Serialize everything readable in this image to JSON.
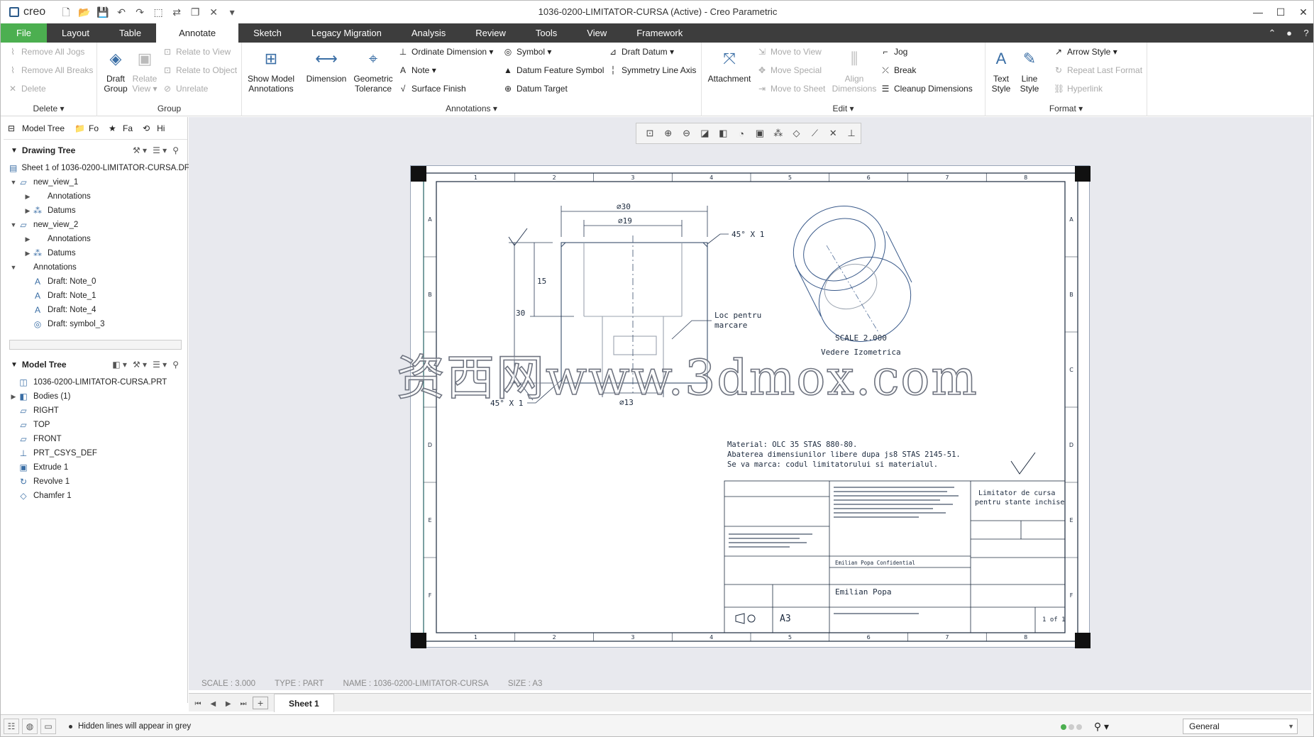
{
  "window": {
    "app_name": "creo",
    "title": "1036-0200-LIMITATOR-CURSA (Active) - Creo Parametric"
  },
  "tabs": [
    "File",
    "Layout",
    "Table",
    "Annotate",
    "Sketch",
    "Legacy Migration",
    "Analysis",
    "Review",
    "Tools",
    "View",
    "Framework"
  ],
  "ribbon": {
    "delete_group": {
      "label": "Delete",
      "remove_all_jogs": "Remove All Jogs",
      "remove_all_breaks": "Remove All Breaks",
      "delete": "Delete"
    },
    "group_group": {
      "label": "Group",
      "draft_group": "Draft Group",
      "relate_view": "Relate View",
      "relate_to_view": "Relate to View",
      "relate_to_object": "Relate to Object",
      "unrelate": "Unrelate"
    },
    "annotations_group": {
      "label": "Annotations",
      "show_model_annotations": "Show Model Annotations",
      "dimension": "Dimension",
      "geometric_tolerance": "Geometric Tolerance",
      "ordinate_dimension": "Ordinate Dimension",
      "note": "Note",
      "surface_finish": "Surface Finish",
      "symbol": "Symbol",
      "datum_feature_symbol": "Datum Feature Symbol",
      "datum_target": "Datum Target",
      "draft_datum": "Draft Datum",
      "symmetry_line_axis": "Symmetry Line Axis"
    },
    "edit_group": {
      "label": "Edit",
      "attachment": "Attachment",
      "move_to_view": "Move to View",
      "move_special": "Move Special",
      "move_to_sheet": "Move to Sheet",
      "align_dimensions": "Align Dimensions",
      "jog": "Jog",
      "break": "Break",
      "cleanup_dimensions": "Cleanup Dimensions"
    },
    "format_group": {
      "label": "Format",
      "text_style": "Text Style",
      "line_style": "Line Style",
      "arrow_style": "Arrow Style",
      "repeat_last_format": "Repeat Last Format",
      "hyperlink": "Hyperlink"
    }
  },
  "left_panel": {
    "tabs": [
      "Model Tree",
      "Fo",
      "Fa",
      "Hi"
    ],
    "drawing_tree": {
      "title": "Drawing Tree",
      "items": [
        {
          "label": "Sheet 1 of 1036-0200-LIMITATOR-CURSA.DF",
          "level": 0,
          "tw": "",
          "icon": "sheet-icon"
        },
        {
          "label": "new_view_1",
          "level": 0,
          "tw": "▼",
          "icon": "view-icon"
        },
        {
          "label": "Annotations",
          "level": 1,
          "tw": "▶",
          "icon": ""
        },
        {
          "label": "Datums",
          "level": 1,
          "tw": "▶",
          "icon": "datum-icon"
        },
        {
          "label": "new_view_2",
          "level": 0,
          "tw": "▼",
          "icon": "view-icon"
        },
        {
          "label": "Annotations",
          "level": 1,
          "tw": "▶",
          "icon": ""
        },
        {
          "label": "Datums",
          "level": 1,
          "tw": "▶",
          "icon": "datum-icon"
        },
        {
          "label": "Annotations",
          "level": 0,
          "tw": "▼",
          "icon": ""
        },
        {
          "label": "Draft: Note_0",
          "level": 1,
          "tw": "",
          "icon": "note-icon"
        },
        {
          "label": "Draft: Note_1",
          "level": 1,
          "tw": "",
          "icon": "note-icon"
        },
        {
          "label": "Draft: Note_4",
          "level": 1,
          "tw": "",
          "icon": "note-icon"
        },
        {
          "label": "Draft: symbol_3",
          "level": 1,
          "tw": "",
          "icon": "symbol-icon"
        }
      ]
    },
    "model_tree": {
      "title": "Model Tree",
      "items": [
        {
          "label": "1036-0200-LIMITATOR-CURSA.PRT",
          "level": 0,
          "tw": "",
          "icon": "part-icon"
        },
        {
          "label": "Bodies (1)",
          "level": 0,
          "tw": "▶",
          "icon": "bodies-icon"
        },
        {
          "label": "RIGHT",
          "level": 0,
          "tw": "",
          "icon": "plane-icon"
        },
        {
          "label": "TOP",
          "level": 0,
          "tw": "",
          "icon": "plane-icon"
        },
        {
          "label": "FRONT",
          "level": 0,
          "tw": "",
          "icon": "plane-icon"
        },
        {
          "label": "PRT_CSYS_DEF",
          "level": 0,
          "tw": "",
          "icon": "csys-icon"
        },
        {
          "label": "Extrude 1",
          "level": 0,
          "tw": "",
          "icon": "extrude-icon"
        },
        {
          "label": "Revolve 1",
          "level": 0,
          "tw": "",
          "icon": "revolve-icon"
        },
        {
          "label": "Chamfer 1",
          "level": 0,
          "tw": "",
          "icon": "chamfer-icon"
        }
      ]
    }
  },
  "drawing": {
    "cols": [
      "1",
      "2",
      "3",
      "4",
      "5",
      "6",
      "7",
      "8"
    ],
    "rows": [
      "A",
      "B",
      "C",
      "D",
      "E",
      "F"
    ],
    "dims": {
      "d30": "⌀30",
      "d19": "⌀19",
      "d13": "⌀13",
      "h15": "15",
      "h30": "30",
      "chamfer": "45° X 1"
    },
    "note_mark_1": "Loc pentru",
    "note_mark_2": "marcare",
    "scale_label": "SCALE 2.000",
    "iso_label": "Vedere Izometrica",
    "material_1": "Material: OLC 35 STAS 880-80.",
    "material_2": "Abaterea dimensiunilor libere dupa js8 STAS 2145-51.",
    "material_3": "Se va marca: codul limitatorului si materialul.",
    "tb_desc_1": "Limitator de cursa",
    "tb_desc_2": "pentru stante inchise",
    "tb_size": "A3",
    "tb_author": "Emilian Popa",
    "tb_confidential": "Emilian Popa Confidential",
    "tb_sheet": "1 of 1"
  },
  "canvas_info": {
    "scale": "SCALE : 3.000",
    "type": "TYPE : PART",
    "name": "NAME : 1036-0200-LIMITATOR-CURSA",
    "size": "SIZE : A3"
  },
  "watermark": "资西网www.3dmox.com",
  "sheet_tab": "Sheet 1",
  "status": {
    "message": "Hidden lines will appear in grey",
    "filter": "General"
  }
}
